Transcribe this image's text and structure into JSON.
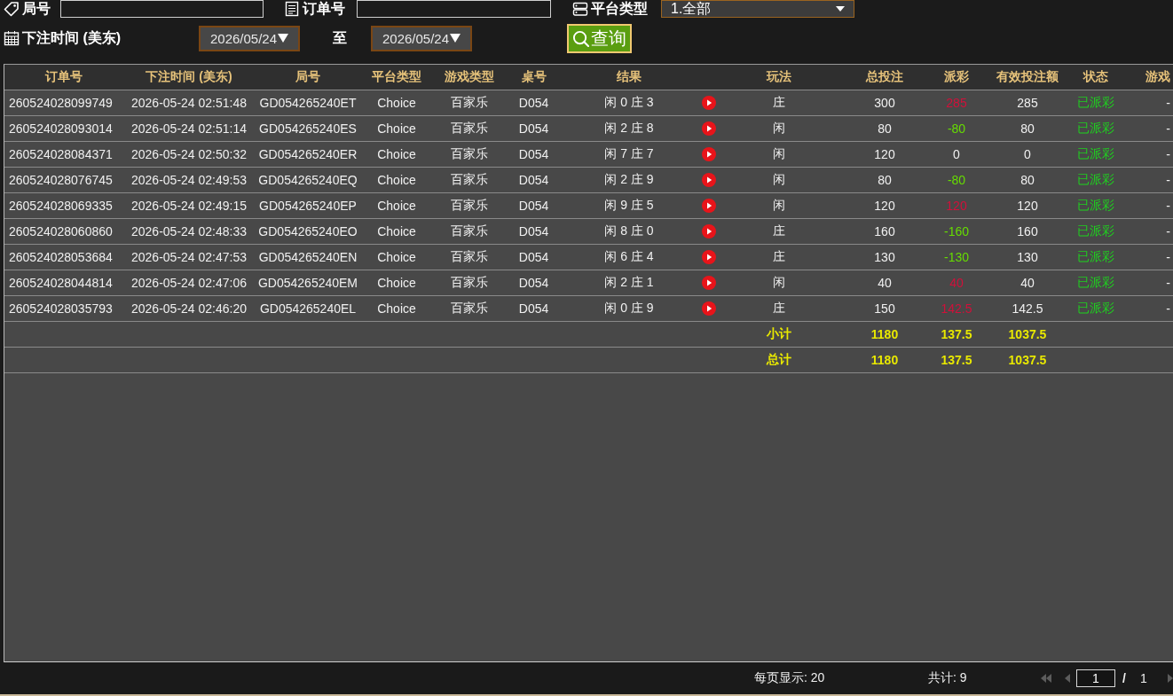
{
  "filters": {
    "round_number": {
      "label": "局号"
    },
    "order_number": {
      "label": "订单号"
    },
    "platform_type": {
      "label": "平台类型",
      "value": "1.全部"
    },
    "bet_time": {
      "label": "下注时间 (美东)",
      "from": "2026/05/24",
      "separator": "至",
      "to": "2026/05/24"
    },
    "query_button": "查询"
  },
  "table": {
    "columns": [
      "订单号",
      "下注时间 (美东)",
      "局号",
      "平台类型",
      "游戏类型",
      "桌号",
      "结果",
      "玩法",
      "总投注",
      "派彩",
      "有效投注额",
      "状态",
      "游戏"
    ],
    "rows": [
      {
        "order_no": "260524028099749",
        "bet_time": "2026-05-24 02:51:48",
        "round_no": "GD054265240ET",
        "platform": "Choice",
        "game_type": "百家乐",
        "table_no": "D054",
        "result": "闲 0 庄 3",
        "play": "庄",
        "total_bet": "300",
        "payout": {
          "text": "285",
          "color": "#d0103a"
        },
        "valid_bet": "285",
        "status": "已派彩",
        "column_14": "-"
      },
      {
        "order_no": "260524028093014",
        "bet_time": "2026-05-24 02:51:14",
        "round_no": "GD054265240ES",
        "platform": "Choice",
        "game_type": "百家乐",
        "table_no": "D054",
        "result": "闲 2 庄 8",
        "play": "闲",
        "total_bet": "80",
        "payout": {
          "text": "-80",
          "color": "#66dd00"
        },
        "valid_bet": "80",
        "status": "已派彩",
        "column_14": "-"
      },
      {
        "order_no": "260524028084371",
        "bet_time": "2026-05-24 02:50:32",
        "round_no": "GD054265240ER",
        "platform": "Choice",
        "game_type": "百家乐",
        "table_no": "D054",
        "result": "闲 7 庄 7",
        "play": "闲",
        "total_bet": "120",
        "payout": {
          "text": "0",
          "color": "#f0f0f0"
        },
        "valid_bet": "0",
        "status": "已派彩",
        "column_14": "-"
      },
      {
        "order_no": "260524028076745",
        "bet_time": "2026-05-24 02:49:53",
        "round_no": "GD054265240EQ",
        "platform": "Choice",
        "game_type": "百家乐",
        "table_no": "D054",
        "result": "闲 2 庄 9",
        "play": "闲",
        "total_bet": "80",
        "payout": {
          "text": "-80",
          "color": "#66dd00"
        },
        "valid_bet": "80",
        "status": "已派彩",
        "column_14": "-"
      },
      {
        "order_no": "260524028069335",
        "bet_time": "2026-05-24 02:49:15",
        "round_no": "GD054265240EP",
        "platform": "Choice",
        "game_type": "百家乐",
        "table_no": "D054",
        "result": "闲 9 庄 5",
        "play": "闲",
        "total_bet": "120",
        "payout": {
          "text": "120",
          "color": "#d0103a"
        },
        "valid_bet": "120",
        "status": "已派彩",
        "column_14": "-"
      },
      {
        "order_no": "260524028060860",
        "bet_time": "2026-05-24 02:48:33",
        "round_no": "GD054265240EO",
        "platform": "Choice",
        "game_type": "百家乐",
        "table_no": "D054",
        "result": "闲 8 庄 0",
        "play": "庄",
        "total_bet": "160",
        "payout": {
          "text": "-160",
          "color": "#66dd00"
        },
        "valid_bet": "160",
        "status": "已派彩",
        "column_14": "-"
      },
      {
        "order_no": "260524028053684",
        "bet_time": "2026-05-24 02:47:53",
        "round_no": "GD054265240EN",
        "platform": "Choice",
        "game_type": "百家乐",
        "table_no": "D054",
        "result": "闲 6 庄 4",
        "play": "庄",
        "total_bet": "130",
        "payout": {
          "text": "-130",
          "color": "#66dd00"
        },
        "valid_bet": "130",
        "status": "已派彩",
        "column_14": "-"
      },
      {
        "order_no": "260524028044814",
        "bet_time": "2026-05-24 02:47:06",
        "round_no": "GD054265240EM",
        "platform": "Choice",
        "game_type": "百家乐",
        "table_no": "D054",
        "result": "闲 2 庄 1",
        "play": "闲",
        "total_bet": "40",
        "payout": {
          "text": "40",
          "color": "#d0103a"
        },
        "valid_bet": "40",
        "status": "已派彩",
        "column_14": "-"
      },
      {
        "order_no": "260524028035793",
        "bet_time": "2026-05-24 02:46:20",
        "round_no": "GD054265240EL",
        "platform": "Choice",
        "game_type": "百家乐",
        "table_no": "D054",
        "result": "闲 0 庄 9",
        "play": "庄",
        "total_bet": "150",
        "payout": {
          "text": "142.5",
          "color": "#d0103a"
        },
        "valid_bet": "142.5",
        "status": "已派彩",
        "column_14": "-"
      }
    ],
    "summary": [
      {
        "label": "小计",
        "total_bet": "1180",
        "payout": "137.5",
        "valid_bet": "1037.5"
      },
      {
        "label": "总计",
        "total_bet": "1180",
        "payout": "137.5",
        "valid_bet": "1037.5"
      }
    ]
  },
  "pagination": {
    "page_size": "每页显示: 20",
    "total": "共计: 9",
    "page": "1",
    "separator": "/",
    "page_count": "1"
  }
}
